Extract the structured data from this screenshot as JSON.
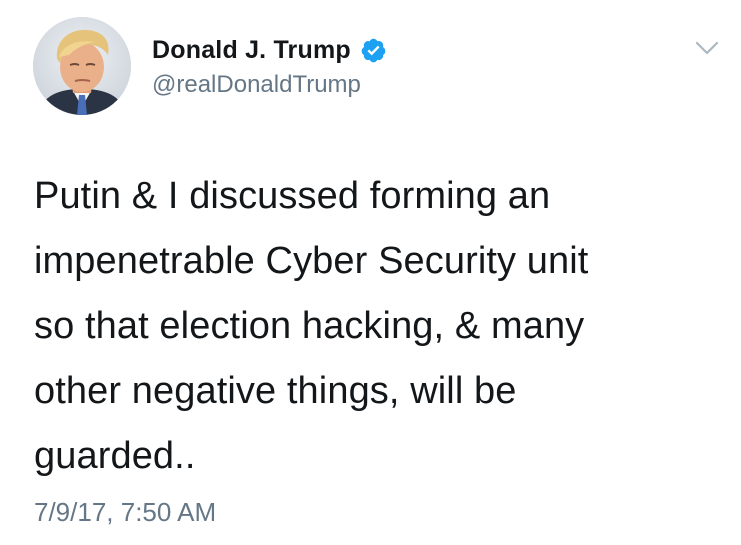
{
  "author": {
    "display_name": "Donald J. Trump",
    "handle": "@realDonaldTrump",
    "verified": true,
    "avatar_icon": "profile-photo",
    "verified_icon": "verified-badge-icon",
    "verified_color": "#1da1f2"
  },
  "menu": {
    "icon": "chevron-down-icon"
  },
  "tweet": {
    "lines": [
      "Putin & I discussed forming an",
      "impenetrable Cyber Security unit",
      "so that election hacking, & many",
      "other negative things, will be",
      "guarded.."
    ],
    "timestamp": "7/9/17, 7:50 AM"
  },
  "colors": {
    "text": "#14171a",
    "secondary_text": "#657786",
    "background": "#ffffff"
  }
}
